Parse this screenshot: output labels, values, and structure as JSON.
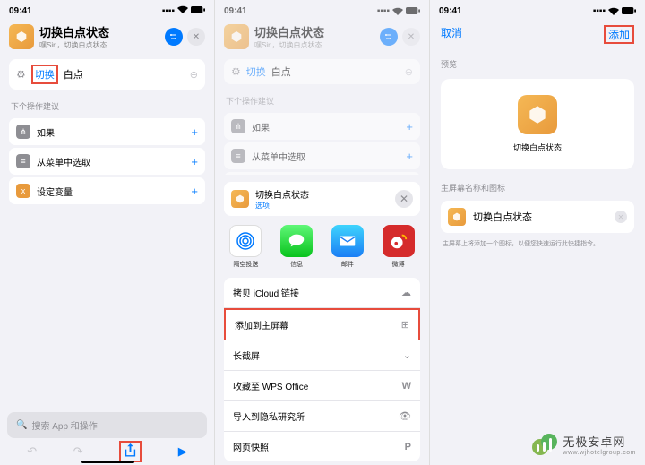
{
  "status": {
    "time": "09:41"
  },
  "shortcut": {
    "title": "切换白点状态",
    "subtitle": "嘿Siri，切换白点状态"
  },
  "search": {
    "action_word": "切换",
    "rest": "白点"
  },
  "suggestions": {
    "label": "下个操作建议",
    "items": [
      {
        "label": "如果",
        "color": "#8e8e93"
      },
      {
        "label": "从菜单中选取",
        "color": "#8e8e93"
      },
      {
        "label": "设定变量",
        "color": "#e89a3c"
      }
    ]
  },
  "bottom_search": {
    "placeholder": "搜索 App 和操作"
  },
  "sheet": {
    "title": "切换白点状态",
    "sub": "选项",
    "apps": [
      {
        "label": "隔空投送"
      },
      {
        "label": "信息"
      },
      {
        "label": "邮件"
      },
      {
        "label": "微博"
      }
    ],
    "list": [
      {
        "label": "拷贝 iCloud 链接",
        "icon": "cloud"
      },
      {
        "label": "添加到主屏幕",
        "icon": "plus-square",
        "highlight": true
      },
      {
        "label": "长截屏",
        "icon": "chevron"
      },
      {
        "label": "收藏至 WPS Office",
        "icon": "wps"
      },
      {
        "label": "导入到隐私研究所",
        "icon": "eye"
      },
      {
        "label": "网页快照",
        "icon": "p"
      }
    ]
  },
  "screen3": {
    "cancel": "取消",
    "add": "添加",
    "preview_label": "预览",
    "shortcut_name": "切换白点状态",
    "name_section": "主屏幕名称和图标",
    "name_value": "切换白点状态",
    "hint": "主屏幕上将添加一个图标，以便您快速运行此快捷指令。"
  },
  "watermark": {
    "name": "无极安卓网",
    "url": "www.wjhotelgroup.com"
  }
}
